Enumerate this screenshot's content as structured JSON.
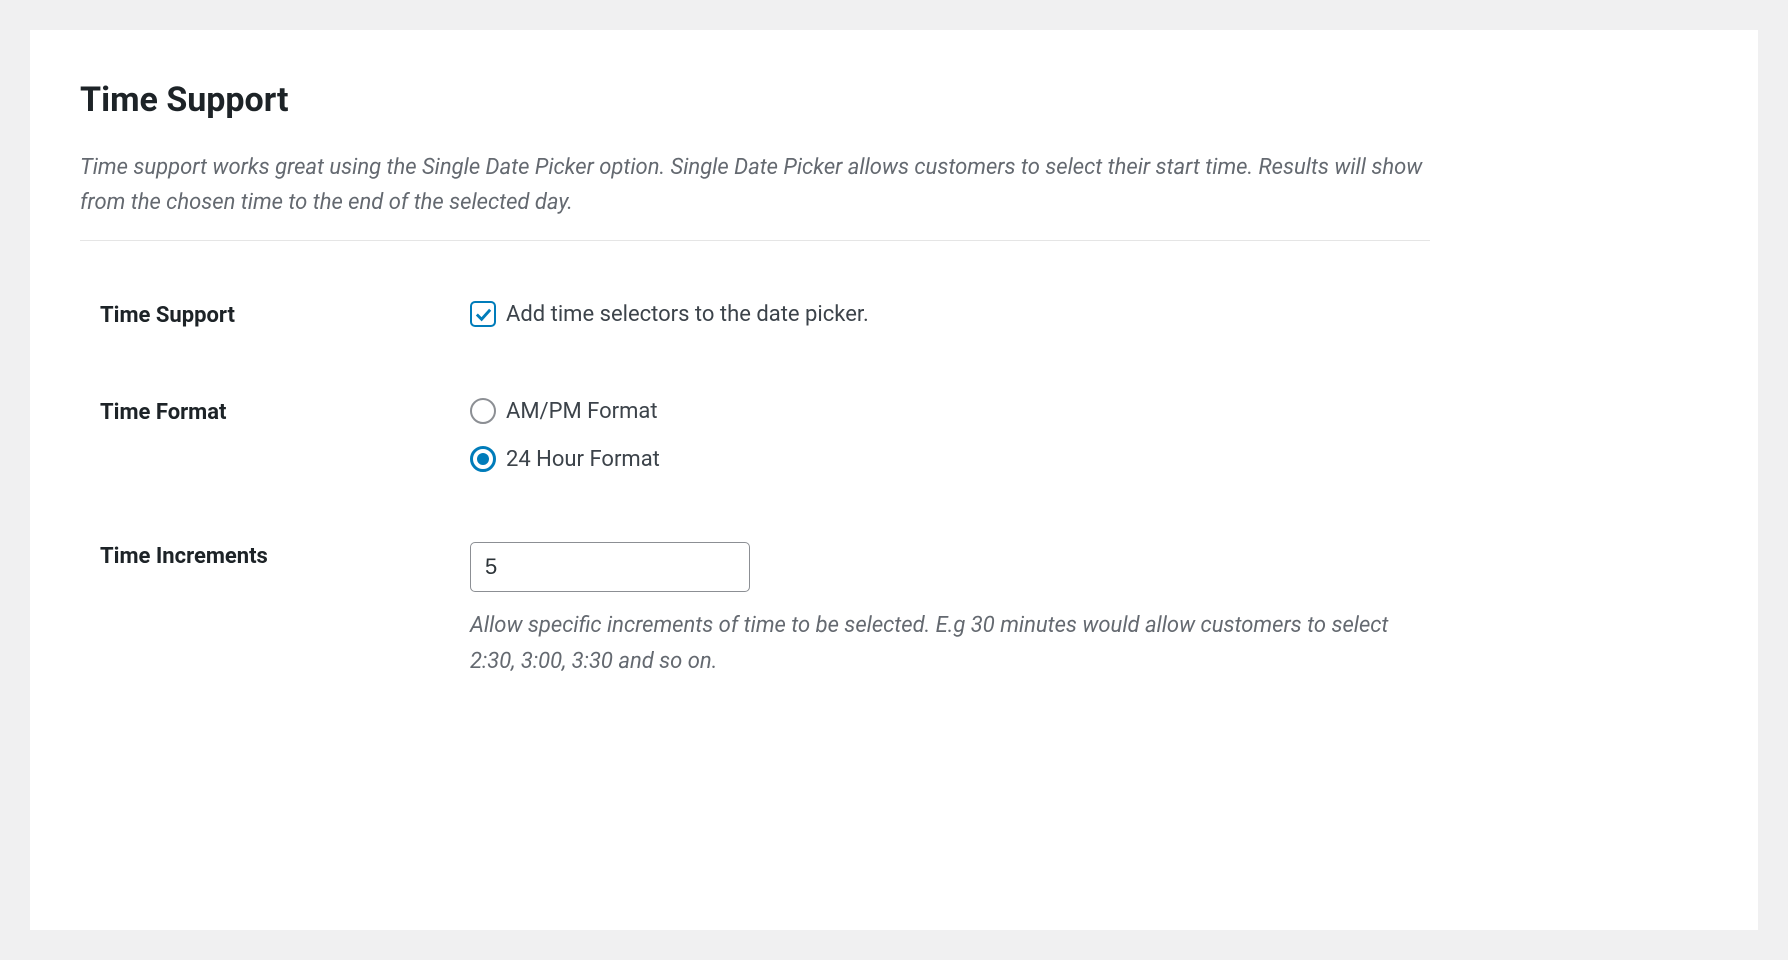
{
  "section": {
    "title": "Time Support",
    "description": "Time support works great using the Single Date Picker option. Single Date Picker allows customers to select their start time. Results will show from the chosen time to the end of the selected day."
  },
  "fields": {
    "time_support": {
      "label": "Time Support",
      "checkbox_label": "Add time selectors to the date picker.",
      "checked": true
    },
    "time_format": {
      "label": "Time Format",
      "options": [
        {
          "label": "AM/PM Format",
          "selected": false
        },
        {
          "label": "24 Hour Format",
          "selected": true
        }
      ]
    },
    "time_increments": {
      "label": "Time Increments",
      "value": "5",
      "help": "Allow specific increments of time to be selected. E.g 30 minutes would allow customers to select 2:30, 3:00, 3:30 and so on."
    }
  }
}
